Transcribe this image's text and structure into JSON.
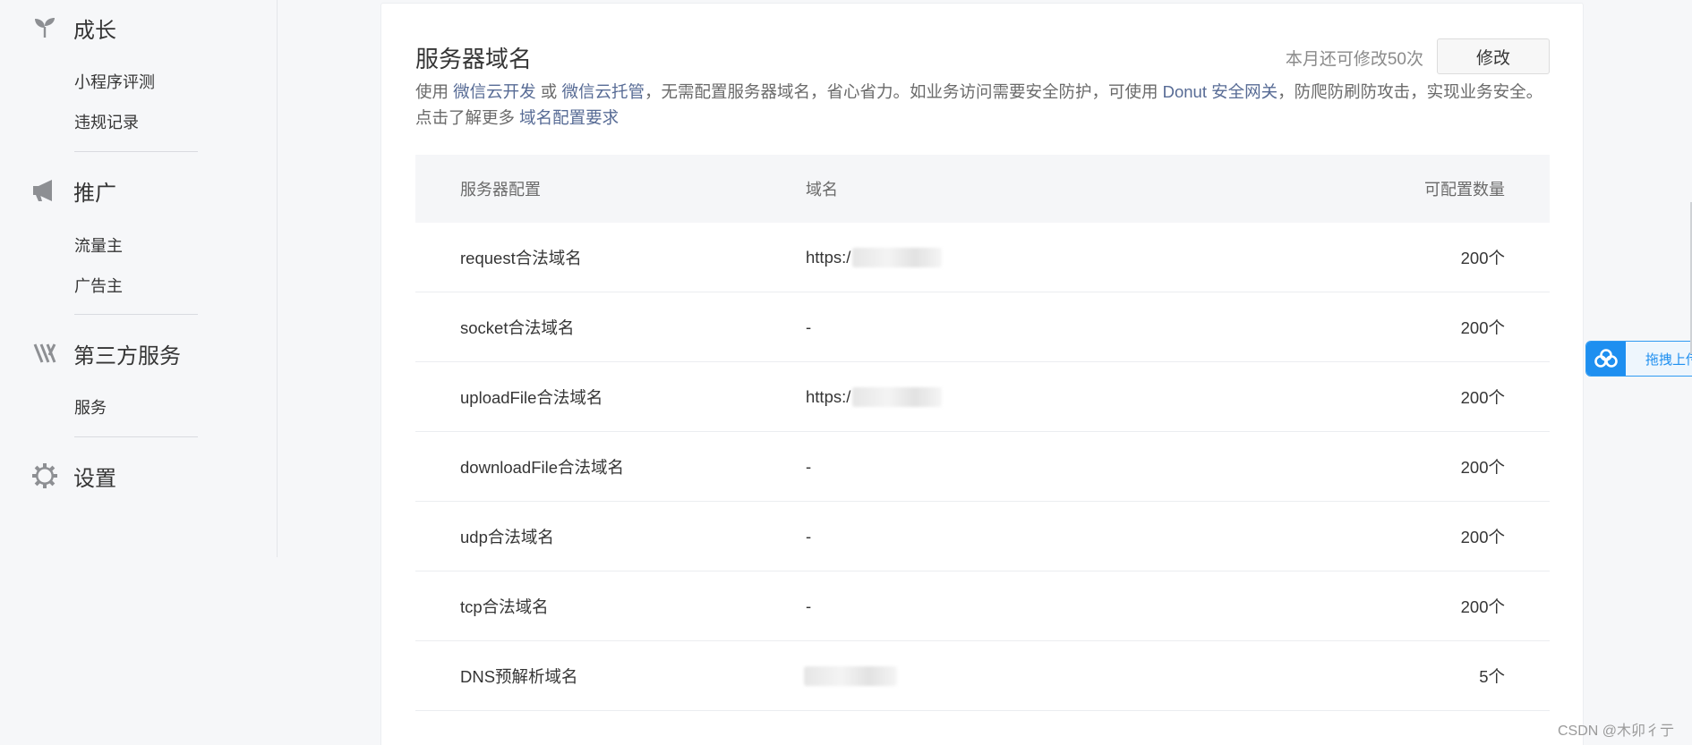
{
  "sidebar": {
    "groups": [
      {
        "icon": "sprout-icon",
        "title": "成长",
        "items": [
          "小程序评测",
          "违规记录"
        ]
      },
      {
        "icon": "megaphone-icon",
        "title": "推广",
        "items": [
          "流量主",
          "广告主"
        ]
      },
      {
        "icon": "third-party-icon",
        "title": "第三方服务",
        "items": [
          "服务"
        ]
      },
      {
        "icon": "gear-icon",
        "title": "设置",
        "items": []
      }
    ]
  },
  "server_domain": {
    "title": "服务器域名",
    "quota_text": "本月还可修改50次",
    "edit_label": "修改",
    "desc": {
      "p1": "使用 ",
      "link1": "微信云开发",
      "p2": " 或 ",
      "link2": "微信云托管",
      "p3": "，无需配置服务器域名，省心省力。如业务访问需要安全防护，可使用 ",
      "link3": "Donut 安全网关",
      "p4": "，防爬防刷防攻击，实现业务安全。点击了解更多 ",
      "link4": "域名配置要求"
    },
    "table": {
      "headers": [
        "服务器配置",
        "域名",
        "可配置数量"
      ],
      "rows": [
        {
          "config": "request合法域名",
          "domain": "https:/",
          "blurred": true,
          "count": "200个"
        },
        {
          "config": "socket合法域名",
          "domain": "-",
          "blurred": false,
          "count": "200个"
        },
        {
          "config": "uploadFile合法域名",
          "domain": "https:/",
          "blurred": true,
          "count": "200个"
        },
        {
          "config": "downloadFile合法域名",
          "domain": "-",
          "blurred": false,
          "count": "200个"
        },
        {
          "config": "udp合法域名",
          "domain": "-",
          "blurred": false,
          "count": "200个"
        },
        {
          "config": "tcp合法域名",
          "domain": "-",
          "blurred": false,
          "count": "200个"
        },
        {
          "config": "DNS预解析域名",
          "domain": "",
          "blurred": true,
          "count": "5个"
        }
      ]
    }
  },
  "float_widget": {
    "icon": "cloud-upload-icon",
    "label": "拖拽上传"
  },
  "watermark": "CSDN @木卯彳亍",
  "colors": {
    "link": "#576b95",
    "widget_accent": "#1e8ff0"
  }
}
